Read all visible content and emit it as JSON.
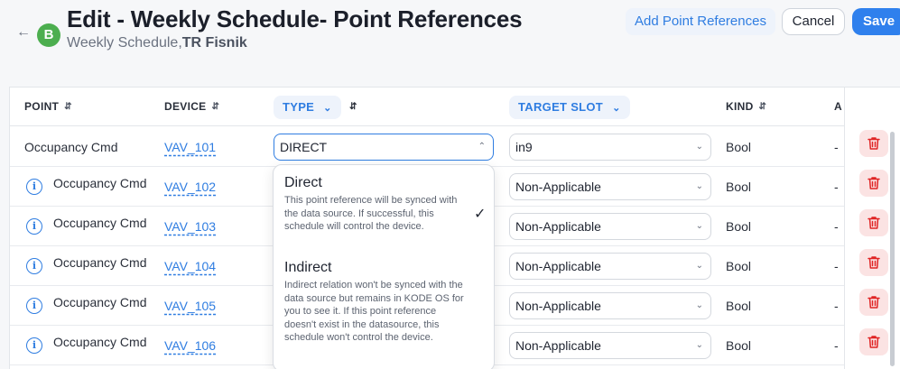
{
  "header": {
    "title": "Edit - Weekly Schedule- Point References",
    "subtitle_prefix": "Weekly Schedule,",
    "subtitle_bold": "TR Fisnik",
    "avatar_letter": "B",
    "add_point_references_label": "Add Point References",
    "cancel_label": "Cancel",
    "save_label": "Save"
  },
  "table": {
    "columns": {
      "point": "POINT",
      "device": "DEVICE",
      "type": "TYPE",
      "target_slot": "TARGET SLOT",
      "kind": "KIND",
      "extra": "A"
    },
    "rows": [
      {
        "point": "Occupancy Cmd",
        "device": "VAV_101",
        "type": "DIRECT",
        "target_slot": "in9",
        "kind": "Bool",
        "extra": "-",
        "info": false
      },
      {
        "point": "Occupancy Cmd",
        "device": "VAV_102",
        "type": "",
        "target_slot": "Non-Applicable",
        "kind": "Bool",
        "extra": "-",
        "info": true
      },
      {
        "point": "Occupancy Cmd",
        "device": "VAV_103",
        "type": "",
        "target_slot": "Non-Applicable",
        "kind": "Bool",
        "extra": "-",
        "info": true
      },
      {
        "point": "Occupancy Cmd",
        "device": "VAV_104",
        "type": "",
        "target_slot": "Non-Applicable",
        "kind": "Bool",
        "extra": "-",
        "info": true
      },
      {
        "point": "Occupancy Cmd",
        "device": "VAV_105",
        "type": "",
        "target_slot": "Non-Applicable",
        "kind": "Bool",
        "extra": "-",
        "info": true
      },
      {
        "point": "Occupancy Cmd",
        "device": "VAV_106",
        "type": "",
        "target_slot": "Non-Applicable",
        "kind": "Bool",
        "extra": "-",
        "info": true
      }
    ]
  },
  "type_dropdown": {
    "options": [
      {
        "title": "Direct",
        "description": "This point reference will be synced with the data source. If successful, this schedule will control the device.",
        "selected": true
      },
      {
        "title": "Indirect",
        "description": "Indirect relation won't be synced with the data source but remains in KODE OS for you to see it. If this point reference doesn't exist in the datasource, this schedule won't control the device.",
        "selected": false
      }
    ]
  },
  "icons": {
    "back": "arrow-left-icon",
    "sort": "sort-updown-icon",
    "info": "info-circle-icon",
    "delete": "trash-icon",
    "check": "checkmark-icon"
  },
  "colors": {
    "accent": "#2f80ed",
    "avatar": "#4cae4f",
    "delete_bg": "#fbe3e3",
    "delete_icon": "#e02424"
  }
}
